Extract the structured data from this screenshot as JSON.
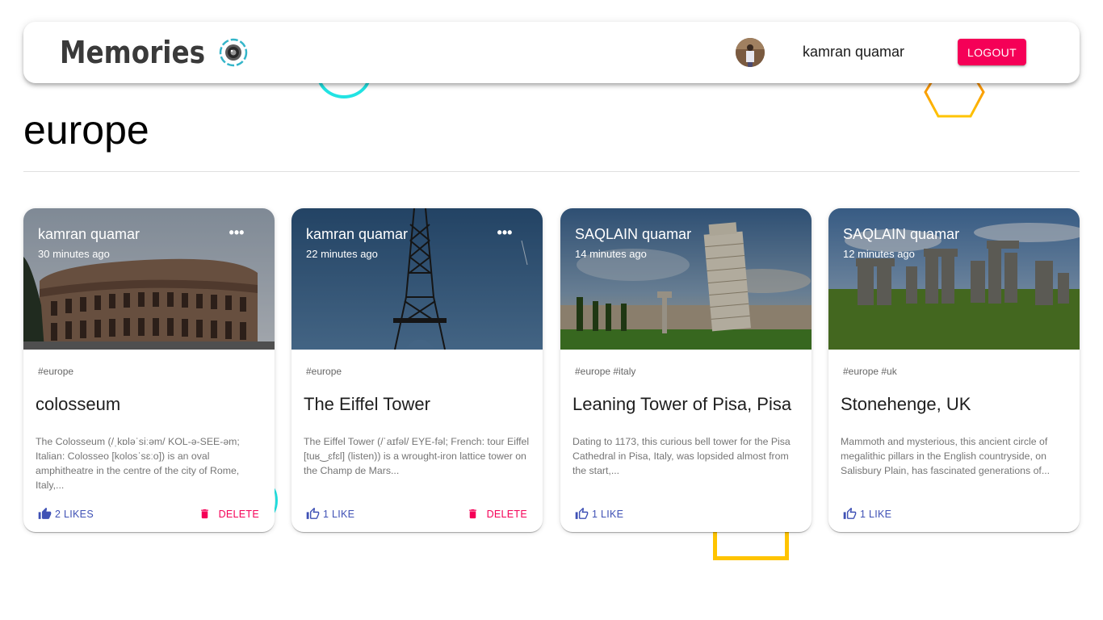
{
  "app": {
    "brand_text": "Memories",
    "brand_icon": "camera-lens-icon",
    "user_name": "kamran quamar",
    "logout_label": "LOGOUT",
    "accent_color": "#f50057",
    "primary_color": "#3f51b5"
  },
  "page": {
    "title": "europe"
  },
  "posts": [
    {
      "author": "kamran quamar",
      "time": "30 minutes ago",
      "tags": "#europe",
      "title": "colosseum",
      "description": "The Colosseum (/ˌkɒləˈsiːəm/ KOL-ə-SEE-əm; Italian: Colosseo [kolosˈsɛːo]) is an oval amphitheatre in the centre of the city of Rome, Italy,...",
      "likes_label": "2 LIKES",
      "delete_label": "DELETE",
      "image": "colosseum-photo"
    },
    {
      "author": "kamran quamar",
      "time": "22 minutes ago",
      "tags": "#europe",
      "title": "The Eiffel Tower",
      "description": "The Eiffel Tower (/ˈaɪfəl/ EYE-fəl; French: tour Eiffel [tuʁ‿ɛfɛl] (listen)) is a wrought-iron lattice tower on the Champ de Mars...",
      "likes_label": "1 LIKE",
      "delete_label": "DELETE",
      "image": "eiffel-tower-photo"
    },
    {
      "author": "SAQLAIN quamar",
      "time": "14 minutes ago",
      "tags": "#europe #italy",
      "title": "Leaning Tower of Pisa, Pisa",
      "description": "Dating to 1173, this curious bell tower for the Pisa Cathedral in Pisa, Italy, was lopsided almost from the start,...",
      "likes_label": "1 LIKE",
      "image": "pisa-tower-photo"
    },
    {
      "author": "SAQLAIN quamar",
      "time": "12 minutes ago",
      "tags": "#europe #uk",
      "title": "Stonehenge, UK",
      "description": "Mammoth and mysterious, this ancient circle of megalithic pillars in the English countryside, on Salisbury Plain, has fascinated generations of...",
      "likes_label": "1 LIKE",
      "image": "stonehenge-photo"
    }
  ]
}
